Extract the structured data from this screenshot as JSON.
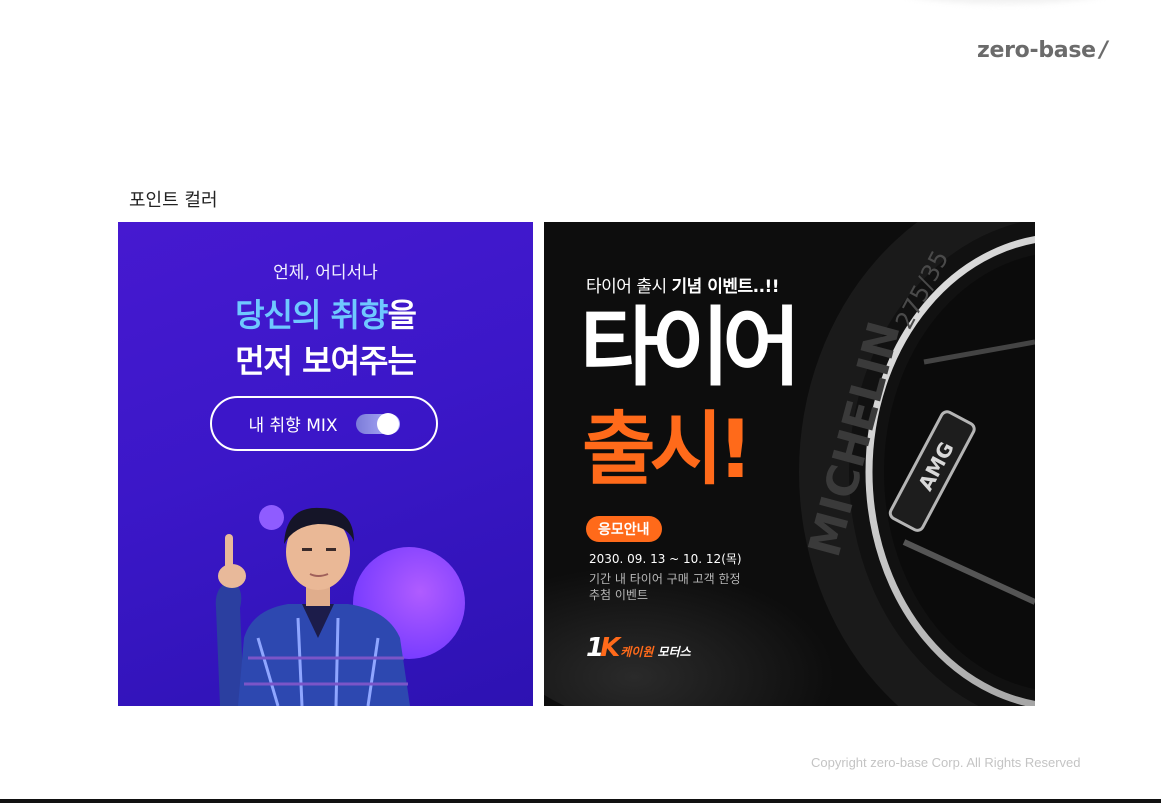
{
  "logo": {
    "text": "zero-base",
    "slash": "/"
  },
  "section_title": "포인트 컬러",
  "left_card": {
    "subtitle": "언제, 어디서나",
    "line1_highlight": "당신의 취향",
    "line1_rest": "을",
    "line2": "먼저 보여주는",
    "pill_label": "내 취향 MIX",
    "toggle_state": "on",
    "colors": {
      "background": "#3b17c8",
      "highlight": "#6fc8ff",
      "accent_bubble": "#7a3dff"
    }
  },
  "right_card": {
    "top_text_normal": "타이어 출시 ",
    "top_text_bold": "기념 이벤트..!!",
    "big_line1": "타이어",
    "big_line2": "출시!",
    "badge": "응모안내",
    "date": "2030. 09. 13 ~ 10. 12(목)",
    "info_line1": "기간 내 타이어 구매 고객 한정",
    "info_line2": "추첨 이벤트",
    "logo_mark_1": "1",
    "logo_mark_k": "K",
    "logo_text_orange": "케이원",
    "logo_text_white": " 모터스",
    "tire_text_1": "275/35",
    "tire_text_2": "MICHELIN",
    "wheel_badge": "AMG",
    "colors": {
      "background": "#0d0d0d",
      "accent": "#ff6a1a"
    }
  },
  "copyright": "Copyright zero-base Corp. All Rights Reserved"
}
